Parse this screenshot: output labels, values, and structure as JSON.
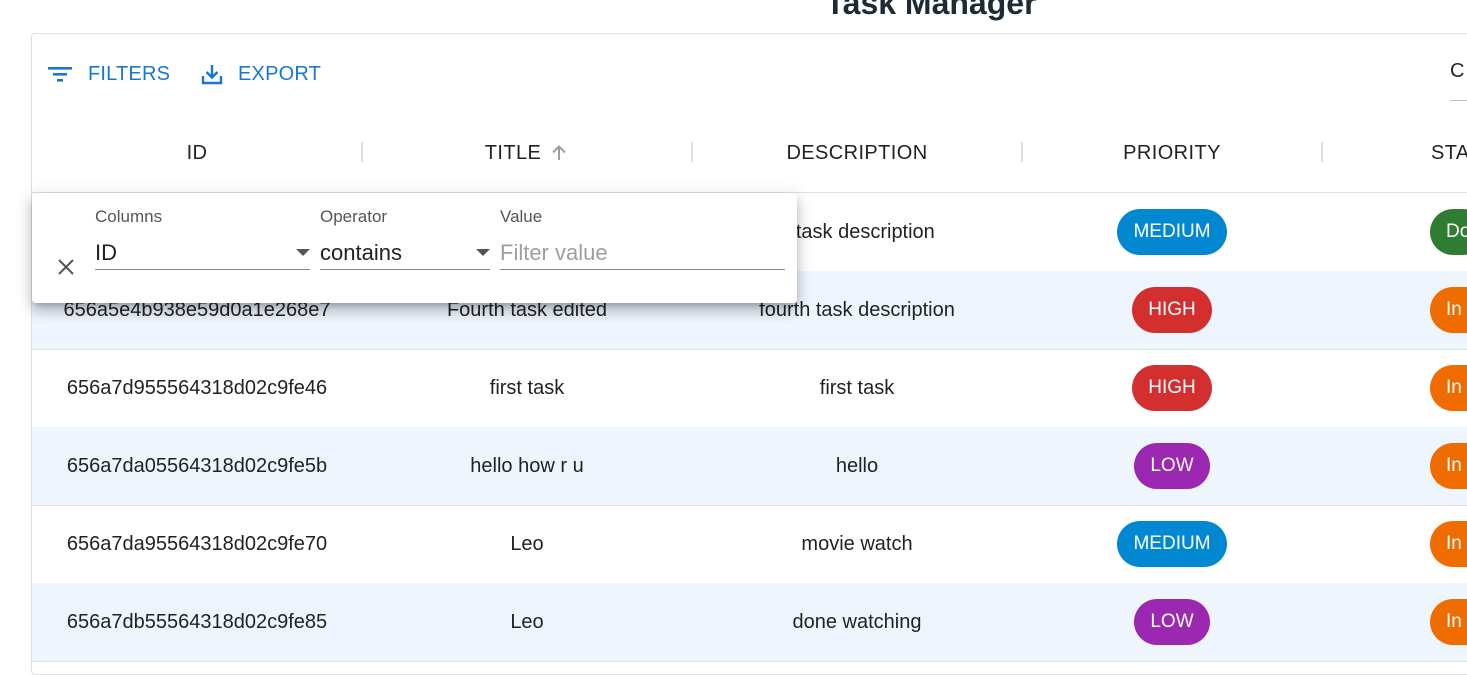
{
  "app": {
    "title": "Task Manager"
  },
  "toolbar": {
    "filters_label": "FILTERS",
    "export_label": "EXPORT",
    "quick_search_value": "C"
  },
  "columns": {
    "id": "ID",
    "title": "TITLE",
    "description": "DESCRIPTION",
    "priority": "PRIORITY",
    "status": "STA"
  },
  "filter_panel": {
    "columns_label": "Columns",
    "columns_value": "ID",
    "operator_label": "Operator",
    "operator_value": "contains",
    "value_label": "Value",
    "value_placeholder": "Filter value"
  },
  "rows": [
    {
      "id": "",
      "title": "",
      "description": "d task description",
      "priority": "MEDIUM",
      "status": "Do"
    },
    {
      "id": "656a5e4b938e59d0a1e268e7",
      "title": "Fourth task edited",
      "description": "fourth task description",
      "priority": "HIGH",
      "status": "In pro"
    },
    {
      "id": "656a7d955564318d02c9fe46",
      "title": "first task",
      "description": "first task",
      "priority": "HIGH",
      "status": "In pro"
    },
    {
      "id": "656a7da05564318d02c9fe5b",
      "title": "hello how r u",
      "description": "hello",
      "priority": "LOW",
      "status": "In pro"
    },
    {
      "id": "656a7da95564318d02c9fe70",
      "title": "Leo",
      "description": "movie watch",
      "priority": "MEDIUM",
      "status": "In pro"
    },
    {
      "id": "656a7db55564318d02c9fe85",
      "title": "Leo",
      "description": "done watching",
      "priority": "LOW",
      "status": "In pro"
    }
  ],
  "colors": {
    "accent": "#1976d2",
    "priority_medium": "#0288d1",
    "priority_high": "#d32f2f",
    "priority_low": "#9c27b0",
    "status_done": "#2e7d32",
    "status_in_progress": "#ef6c00",
    "row_alt": "#eef5fd"
  },
  "icons": {
    "filters": "filter-list-icon",
    "export": "download-icon",
    "sort": "arrow-up-icon",
    "close": "close-icon"
  }
}
